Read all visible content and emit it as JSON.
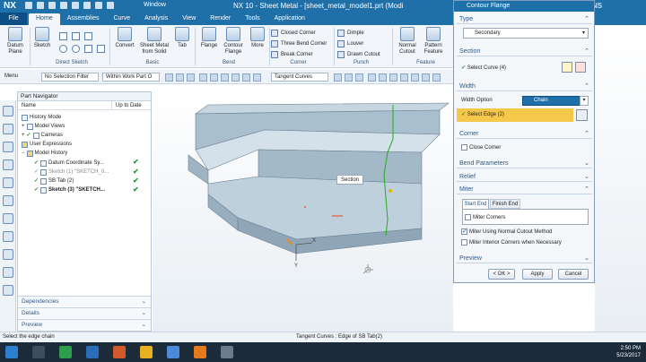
{
  "titlebar": {
    "logo": "NX",
    "window_menu": "Window",
    "title": "NX 10 - Sheet Metal - [sheet_metal_model1.prt (Modi",
    "brand": "NS"
  },
  "ribbon_tabs": {
    "file": "File",
    "tabs": [
      "Home",
      "Assemblies",
      "Curve",
      "Analysis",
      "View",
      "Render",
      "Tools",
      "Application"
    ]
  },
  "ribbon": {
    "datum_plane": "Datum Plane",
    "sketch": "Sketch",
    "direct_sketch_label": "Direct Sketch",
    "convert": "Convert",
    "sheet_metal_from_solid": "Sheet Metal from Solid",
    "tab": "Tab",
    "basic_label": "Basic",
    "flange": "Flange",
    "contour_flange": "Contour Flange",
    "more": "More",
    "bend_label": "Bend",
    "closed_corner": "Closed Corner",
    "three_bend_corner": "Three Bend Corner",
    "break_corner": "Break Corner",
    "corner_label": "Corner",
    "dimple": "Dimple",
    "louver": "Louver",
    "drawn_cutout": "Drawn Cutout",
    "punch_label": "Punch",
    "normal_cutout": "Normal Cutout",
    "pattern_feature": "Pattern Feature",
    "feature_label": "Feature"
  },
  "selbar": {
    "menu": "Menu",
    "filter": "No Selection Filter",
    "scope": "Within Work Part O",
    "curve_rule": "Tangent Curves"
  },
  "navigator": {
    "title": "Part Navigator",
    "col_name": "Name",
    "col_uptodate": "Up to Date",
    "items": [
      "History Mode",
      "Model Views",
      "Cameras",
      "User Expressions",
      "Model History",
      "Datum Coordinate Sy...",
      "Sketch (1) \"SKETCH_0...",
      "SB Tab (2)",
      "Sketch (3) \"SKETCH..."
    ],
    "dependencies": "Dependencies",
    "details": "Details",
    "preview": "Preview"
  },
  "graphics": {
    "tooltip": "Section",
    "axis_x": "X",
    "axis_y": "Y"
  },
  "dialog": {
    "title": "Contour Flange",
    "type_label": "Type",
    "type_value": "Secondary",
    "section_label": "Section",
    "select_curve": "Select Curve (4)",
    "width_label": "Width",
    "width_option_label": "Width Option",
    "width_option_value": "Chain",
    "select_edge": "Select Edge (2)",
    "corner_label": "Corner",
    "close_corner": "Close Corner",
    "bend_params": "Bend Parameters",
    "relief": "Relief",
    "miter": "Miter",
    "start_end": "Start End",
    "finish_end": "Finish End",
    "miter_corners": "Miter Corners",
    "miter_normal": "Miter Using Normal Cutout Method",
    "miter_interior": "Miter Interior Corners when Necessary",
    "preview": "Preview",
    "ok": "< OK >",
    "apply": "Apply",
    "cancel": "Cancel"
  },
  "status": {
    "left": "Select the edge chain",
    "center": "Tangent Curves : Edge of SB Tab(2)"
  },
  "taskbar": {
    "time": "2:50 PM",
    "date": "5/23/2017"
  },
  "colors": {
    "accent": "#1f6fa8",
    "select_highlight": "#f5c84c",
    "model_face": "#b8cad6"
  }
}
